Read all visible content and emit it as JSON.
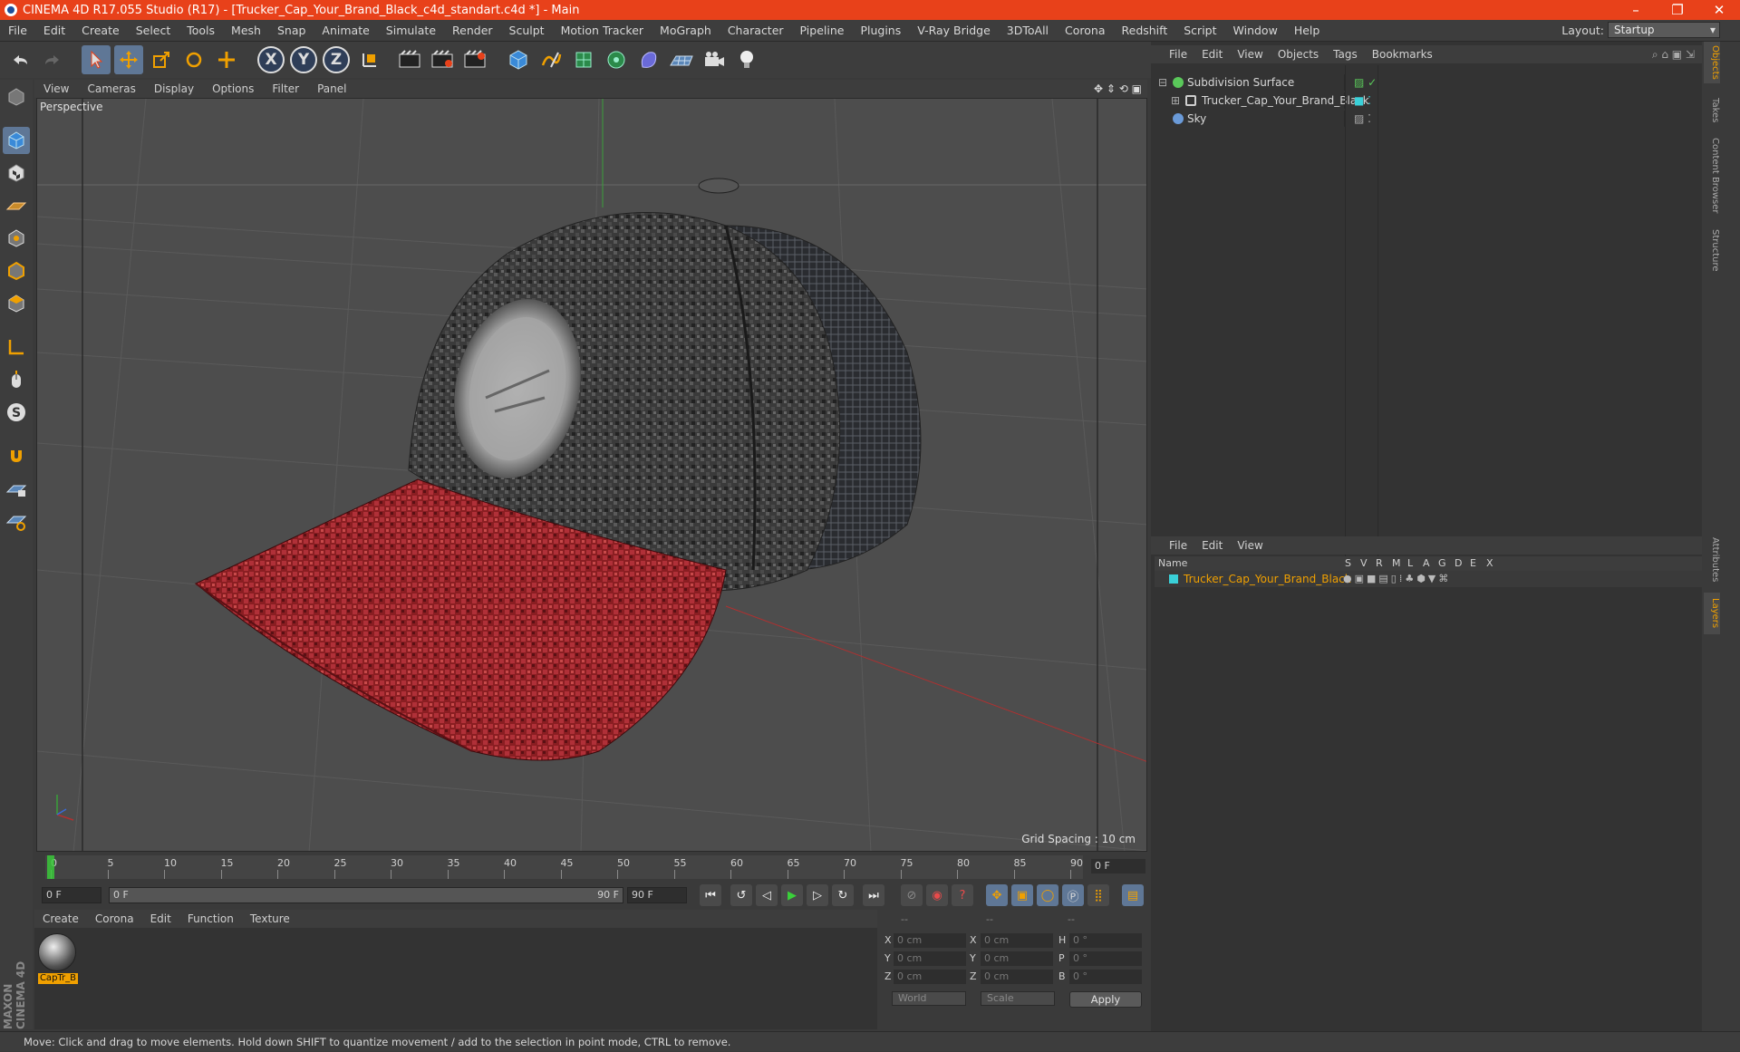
{
  "window": {
    "title": "CINEMA 4D R17.055 Studio (R17) - [Trucker_Cap_Your_Brand_Black_c4d_standart.c4d *] - Main",
    "minimize": "–",
    "restore": "❐",
    "close": "✕"
  },
  "menubar": {
    "items": [
      "File",
      "Edit",
      "Create",
      "Select",
      "Tools",
      "Mesh",
      "Snap",
      "Animate",
      "Simulate",
      "Render",
      "Sculpt",
      "Motion Tracker",
      "MoGraph",
      "Character",
      "Pipeline",
      "Plugins",
      "V-Ray Bridge",
      "3DToAll",
      "Corona",
      "Redshift",
      "Script",
      "Window",
      "Help"
    ],
    "layout_label": "Layout:",
    "layout_value": "Startup"
  },
  "toolbar": {
    "axis_x": "X",
    "axis_y": "Y",
    "axis_z": "Z"
  },
  "viewport": {
    "menu": [
      "View",
      "Cameras",
      "Display",
      "Options",
      "Filter",
      "Panel"
    ],
    "label": "Perspective",
    "grid_spacing": "Grid Spacing : 10 cm"
  },
  "timeline": {
    "ticks": [
      "0",
      "5",
      "10",
      "15",
      "20",
      "25",
      "30",
      "35",
      "40",
      "45",
      "50",
      "55",
      "60",
      "65",
      "70",
      "75",
      "80",
      "85",
      "90"
    ],
    "current_frame": "0 F",
    "start_field": "0 F",
    "range_start": "0 F",
    "range_end": "90 F",
    "end_field": "90 F"
  },
  "materials": {
    "menu": [
      "Create",
      "Corona",
      "Edit",
      "Function",
      "Texture"
    ],
    "items": [
      {
        "name": "CapTr_B"
      }
    ]
  },
  "coordinates": {
    "headers": [
      "--",
      "--",
      "--"
    ],
    "rows": [
      {
        "l1": "X",
        "v1": "0 cm",
        "l2": "X",
        "v2": "0 cm",
        "l3": "H",
        "v3": "0 °"
      },
      {
        "l1": "Y",
        "v1": "0 cm",
        "l2": "Y",
        "v2": "0 cm",
        "l3": "P",
        "v3": "0 °"
      },
      {
        "l1": "Z",
        "v1": "0 cm",
        "l2": "Z",
        "v2": "0 cm",
        "l3": "B",
        "v3": "0 °"
      }
    ],
    "space": "World",
    "mode": "Scale",
    "apply": "Apply"
  },
  "objects": {
    "menu": [
      "File",
      "Edit",
      "View",
      "Objects",
      "Tags",
      "Bookmarks"
    ],
    "items": [
      {
        "name": "Subdivision Surface",
        "icon_color": "#5ac85a"
      },
      {
        "name": "Trucker_Cap_Your_Brand_Black",
        "icon_color": "#cfcfcf"
      },
      {
        "name": "Sky",
        "icon_color": "#6a9ad8"
      }
    ]
  },
  "layers": {
    "menu": [
      "File",
      "Edit",
      "View"
    ],
    "header_name": "Name",
    "header_cols": [
      "S",
      "V",
      "R",
      "M",
      "L",
      "A",
      "G",
      "D",
      "E",
      "X"
    ],
    "items": [
      {
        "name": "Trucker_Cap_Your_Brand_Black",
        "color": "#3ad0d8"
      }
    ]
  },
  "side_tabs": [
    "Objects",
    "Takes",
    "Content Browser",
    "Structure",
    "Attributes",
    "Layers"
  ],
  "brand": "MAXON CINEMA 4D",
  "status": "Move: Click and drag to move elements. Hold down SHIFT to quantize movement / add to the selection in point mode, CTRL to remove.",
  "colors": {
    "accent": "#e8411a",
    "active_tool": "#5f7796",
    "highlight": "#f0a000"
  }
}
